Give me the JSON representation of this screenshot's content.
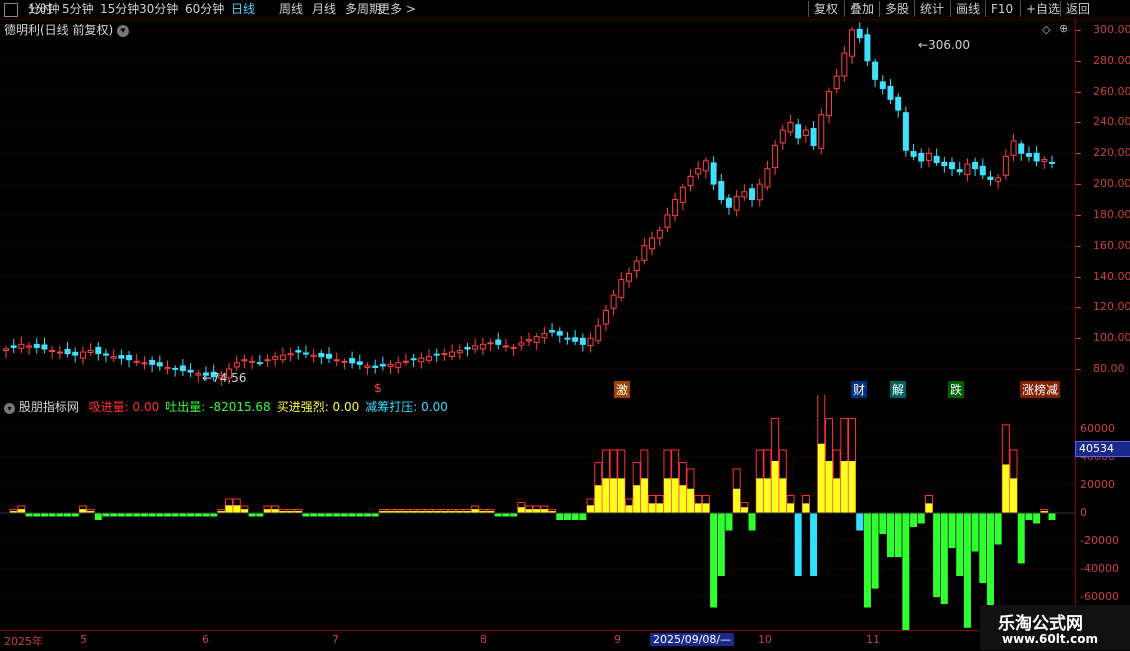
{
  "toolbar": {
    "left": [
      "分时",
      "1分钟",
      "5分钟",
      "15分钟",
      "30分钟",
      "60分钟",
      "日线",
      "周线",
      "月线",
      "多周期",
      "更多 >"
    ],
    "active": "日线",
    "right": [
      "复权",
      "叠加",
      "多股",
      "统计",
      "画线",
      "F10",
      "+自选",
      "返回"
    ]
  },
  "header": {
    "title": "德明利(日线 前复权)"
  },
  "price_axis": [
    "300.00",
    "280.00",
    "260.00",
    "240.00",
    "220.00",
    "200.00",
    "180.00",
    "160.00",
    "140.00",
    "120.00",
    "100.00",
    "80.00"
  ],
  "annotations": {
    "high": "306.00",
    "low": "74.56"
  },
  "events": [
    {
      "label": "$",
      "color": "#ff4040"
    },
    {
      "label": "激",
      "color": "#ffffff",
      "bg": "#a04000"
    },
    {
      "label": "财",
      "color": "#ffffff",
      "bg": "#003080"
    },
    {
      "label": "解",
      "color": "#ffffff",
      "bg": "#006060"
    },
    {
      "label": "跌",
      "color": "#ffffff",
      "bg": "#006000"
    },
    {
      "label": "涨榜减",
      "color": "#ffffff",
      "bg": "#802000"
    }
  ],
  "indicator": {
    "name": "股朋指标网",
    "items": [
      {
        "label": "吸进量:",
        "value": "0.00",
        "color": "#ff3030"
      },
      {
        "label": "吐出量:",
        "value": "-82015.68",
        "color": "#30ff30"
      },
      {
        "label": "买进强烈:",
        "value": "0.00",
        "color": "#ffff30"
      },
      {
        "label": "减筹打压:",
        "value": "0.00",
        "color": "#30e0ff"
      }
    ],
    "axis": [
      "60000",
      "40000",
      "20000",
      "0",
      "-20000",
      "-40000",
      "-60000"
    ],
    "cursor_value": "40534"
  },
  "dates": [
    "2025年",
    "5",
    "6",
    "7",
    "8",
    "9",
    "2025/09/08/—",
    "10",
    "11"
  ],
  "watermark": {
    "title": "乐淘公式网",
    "url": "www.60lt.com"
  },
  "chart_data": {
    "type": "candlestick",
    "ylim": [
      70,
      310
    ],
    "note": "daily candles approx",
    "close": [
      93,
      94,
      96,
      95,
      94,
      93,
      92,
      91,
      90,
      89,
      91,
      92,
      90,
      89,
      88,
      87,
      86,
      85,
      84,
      83,
      82,
      81,
      80,
      79,
      78,
      77,
      76,
      75,
      76,
      80,
      84,
      86,
      85,
      84,
      86,
      88,
      89,
      90,
      91,
      90,
      89,
      88,
      87,
      86,
      85,
      84,
      83,
      82,
      81,
      82,
      83,
      84,
      85,
      86,
      87,
      88,
      89,
      90,
      91,
      92,
      93,
      95,
      96,
      97,
      96,
      95,
      94,
      97,
      99,
      101,
      103,
      104,
      102,
      100,
      98,
      96,
      100,
      108,
      118,
      128,
      138,
      142,
      150,
      160,
      165,
      170,
      180,
      190,
      198,
      205,
      210,
      215,
      200,
      190,
      185,
      192,
      195,
      190,
      200,
      210,
      225,
      235,
      240,
      230,
      235,
      225,
      245,
      260,
      270,
      285,
      300,
      295,
      280,
      268,
      262,
      255,
      248,
      222,
      218,
      215,
      220,
      214,
      212,
      210,
      208,
      213,
      210,
      206,
      203,
      204,
      218,
      228,
      220,
      218,
      215,
      216,
      214
    ]
  }
}
